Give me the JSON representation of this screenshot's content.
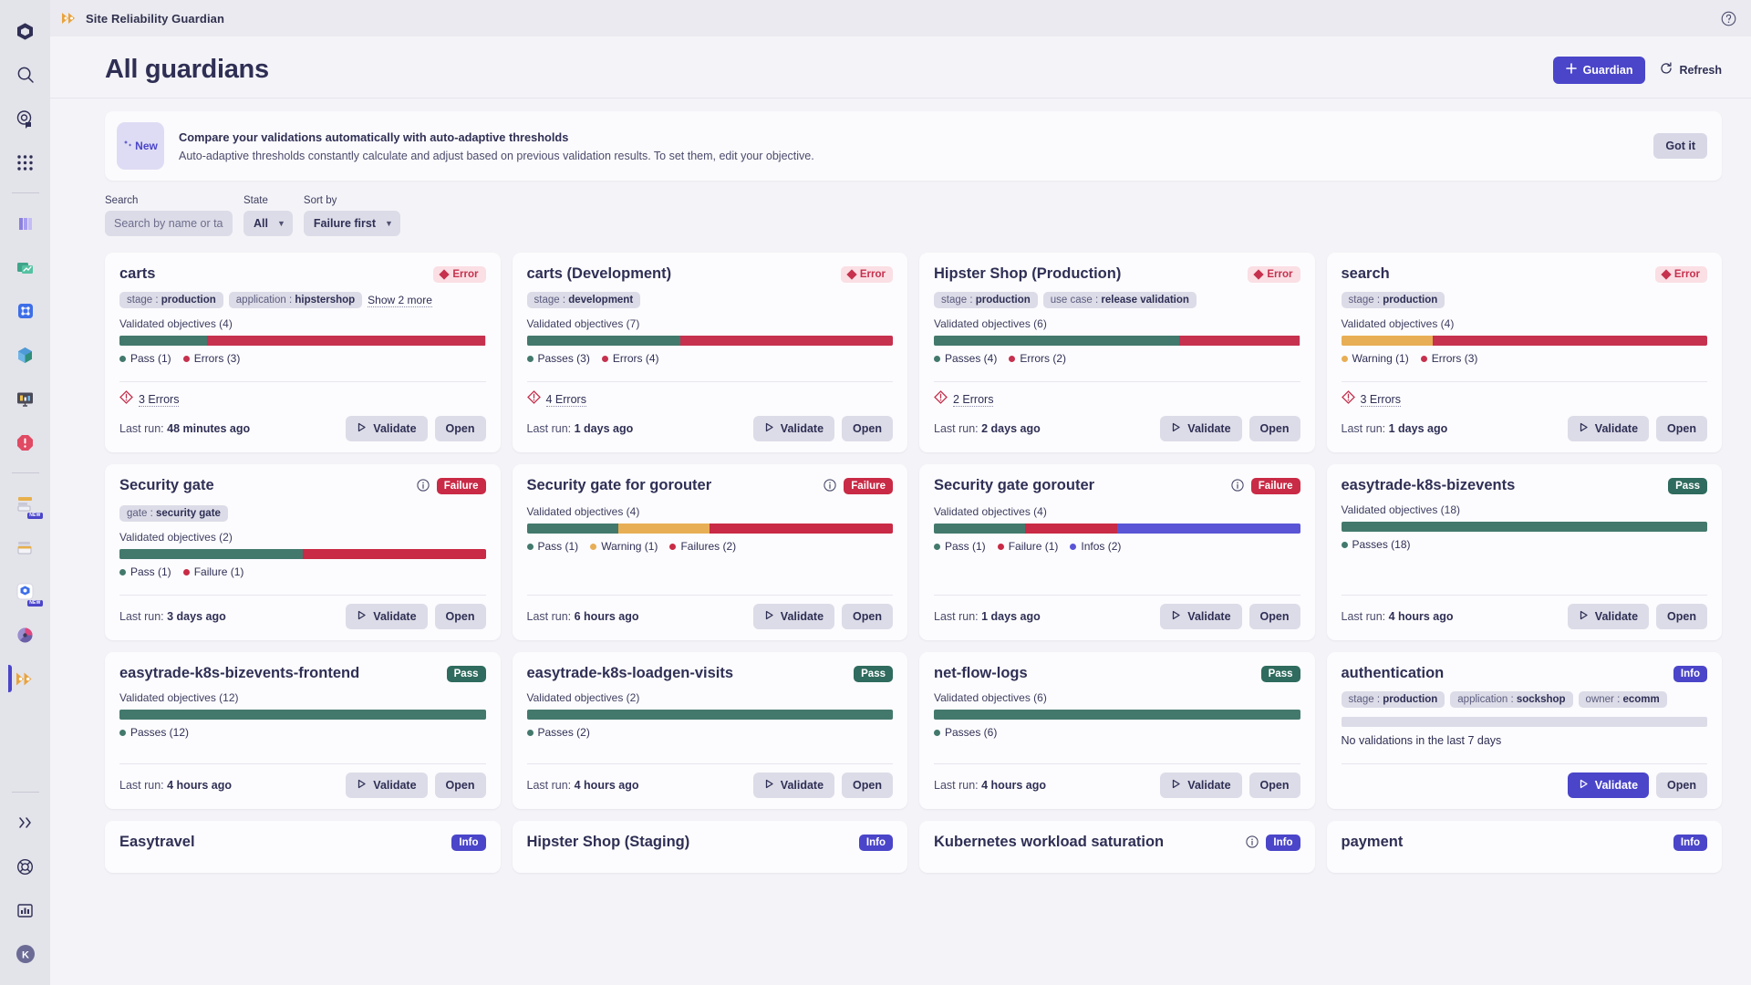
{
  "topbar": {
    "app_title": "Site Reliability Guardian",
    "logo_icon": "guardian-logo-icon",
    "help_icon": "help-circle-icon"
  },
  "page": {
    "title": "All guardians",
    "new_guardian_label": "Guardian",
    "new_guardian_icon": "plus-icon",
    "refresh_label": "Refresh",
    "refresh_icon": "refresh-icon"
  },
  "banner": {
    "chip_label": "New",
    "chip_icon": "sparkle-icon",
    "title": "Compare your validations automatically with auto-adaptive thresholds",
    "subtitle": "Auto-adaptive thresholds constantly calculate and adjust based on previous validation results. To set them, edit your objective.",
    "dismiss_label": "Got it"
  },
  "filters": {
    "search_label": "Search",
    "search_placeholder": "Search by name or tag",
    "search_value": "",
    "state_label": "State",
    "state_value": "All",
    "sort_label": "Sort by",
    "sort_value": "Failure first"
  },
  "colors": {
    "pass": "#43796d",
    "error": "#c6314e",
    "failure": "#c92a45",
    "warning": "#e8ae55",
    "info": "#5a55d6",
    "accent": "#4a45c9",
    "empty": "#dcdce8"
  },
  "labels": {
    "validate": "Validate",
    "open": "Open",
    "validated_objectives": "Validated objectives",
    "last_run_prefix": "Last run:"
  },
  "sidebar": {
    "items": [
      {
        "name": "cube-logo-icon",
        "badge": ""
      },
      {
        "name": "search-icon",
        "badge": ""
      },
      {
        "name": "davis-copilot-icon",
        "badge": ""
      },
      {
        "name": "apps-grid-icon",
        "badge": ""
      },
      {
        "name": "notebooks-icon",
        "badge": ""
      },
      {
        "name": "dashboards-icon",
        "badge": ""
      },
      {
        "name": "kubernetes-app-icon",
        "badge": ""
      },
      {
        "name": "distributed-tracing-icon",
        "badge": ""
      },
      {
        "name": "infrastructure-observability-icon",
        "badge": ""
      },
      {
        "name": "problems-icon",
        "badge": ""
      },
      {
        "name": "workflows-icon",
        "badge": "NEW"
      },
      {
        "name": "segments-icon",
        "badge": ""
      },
      {
        "name": "kubernetes-icon",
        "badge": "NEW"
      },
      {
        "name": "slo-icon",
        "badge": ""
      },
      {
        "name": "site-reliability-guardian-icon",
        "badge": ""
      }
    ],
    "footer_items": [
      {
        "name": "expand-chevrons-icon"
      },
      {
        "name": "lifebuoy-icon"
      },
      {
        "name": "account-usage-icon"
      },
      {
        "name": "user-avatar-icon"
      }
    ]
  },
  "cards": [
    {
      "title": "carts",
      "status": "Error",
      "status_type": "error",
      "has_info": false,
      "tags": [
        {
          "k": "stage",
          "v": "production"
        },
        {
          "k": "application",
          "v": "hipstershop"
        }
      ],
      "show_more": "Show 2 more",
      "objectives_count": "4",
      "segments": [
        {
          "color": "#43796d",
          "pct": 24
        },
        {
          "color": "#c6314e",
          "pct": 76
        }
      ],
      "legend": [
        {
          "label": "Pass (1)",
          "color": "#43796d"
        },
        {
          "label": "Errors (3)",
          "color": "#c6314e"
        }
      ],
      "errors_text": "3 Errors",
      "last_run": "48 minutes ago",
      "validate_accent": false
    },
    {
      "title": "carts (Development)",
      "status": "Error",
      "status_type": "error",
      "has_info": false,
      "tags": [
        {
          "k": "stage",
          "v": "development"
        }
      ],
      "show_more": "",
      "objectives_count": "7",
      "segments": [
        {
          "color": "#43796d",
          "pct": 42
        },
        {
          "color": "#c6314e",
          "pct": 58
        }
      ],
      "legend": [
        {
          "label": "Passes (3)",
          "color": "#43796d"
        },
        {
          "label": "Errors (4)",
          "color": "#c6314e"
        }
      ],
      "errors_text": "4 Errors",
      "last_run": "1 days ago",
      "validate_accent": false
    },
    {
      "title": "Hipster Shop (Production)",
      "status": "Error",
      "status_type": "error",
      "has_info": false,
      "tags": [
        {
          "k": "stage",
          "v": "production"
        },
        {
          "k": "use case",
          "v": "release validation"
        }
      ],
      "show_more": "",
      "objectives_count": "6",
      "segments": [
        {
          "color": "#43796d",
          "pct": 67
        },
        {
          "color": "#c6314e",
          "pct": 33
        }
      ],
      "legend": [
        {
          "label": "Passes (4)",
          "color": "#43796d"
        },
        {
          "label": "Errors (2)",
          "color": "#c6314e"
        }
      ],
      "errors_text": "2 Errors",
      "last_run": "2 days ago",
      "validate_accent": false
    },
    {
      "title": "search",
      "status": "Error",
      "status_type": "error",
      "has_info": false,
      "tags": [
        {
          "k": "stage",
          "v": "production"
        }
      ],
      "show_more": "",
      "objectives_count": "4",
      "segments": [
        {
          "color": "#e8ae55",
          "pct": 25
        },
        {
          "color": "#c6314e",
          "pct": 75
        }
      ],
      "legend": [
        {
          "label": "Warning (1)",
          "color": "#e8ae55"
        },
        {
          "label": "Errors (3)",
          "color": "#c6314e"
        }
      ],
      "errors_text": "3 Errors",
      "last_run": "1 days ago",
      "validate_accent": false
    },
    {
      "title": "Security gate",
      "status": "Failure",
      "status_type": "failure",
      "has_info": true,
      "tags": [
        {
          "k": "gate",
          "v": "security gate"
        }
      ],
      "show_more": "",
      "objectives_count": "2",
      "segments": [
        {
          "color": "#43796d",
          "pct": 50
        },
        {
          "color": "#c92a45",
          "pct": 50
        }
      ],
      "legend": [
        {
          "label": "Pass (1)",
          "color": "#43796d"
        },
        {
          "label": "Failure (1)",
          "color": "#c92a45"
        }
      ],
      "errors_text": "",
      "last_run": "3 days ago",
      "validate_accent": false
    },
    {
      "title": "Security gate for gorouter",
      "status": "Failure",
      "status_type": "failure",
      "has_info": true,
      "tags": [],
      "show_more": "",
      "objectives_count": "4",
      "segments": [
        {
          "color": "#43796d",
          "pct": 25
        },
        {
          "color": "#e8ae55",
          "pct": 25
        },
        {
          "color": "#c92a45",
          "pct": 50
        }
      ],
      "legend": [
        {
          "label": "Pass (1)",
          "color": "#43796d"
        },
        {
          "label": "Warning (1)",
          "color": "#e8ae55"
        },
        {
          "label": "Failures (2)",
          "color": "#c92a45"
        }
      ],
      "errors_text": "",
      "last_run": "6 hours ago",
      "validate_accent": false
    },
    {
      "title": "Security gate gorouter",
      "status": "Failure",
      "status_type": "failure",
      "has_info": true,
      "tags": [],
      "show_more": "",
      "objectives_count": "4",
      "segments": [
        {
          "color": "#43796d",
          "pct": 25
        },
        {
          "color": "#c92a45",
          "pct": 25
        },
        {
          "color": "#5a55d6",
          "pct": 50
        }
      ],
      "legend": [
        {
          "label": "Pass (1)",
          "color": "#43796d"
        },
        {
          "label": "Failure (1)",
          "color": "#c92a45"
        },
        {
          "label": "Infos (2)",
          "color": "#5a55d6"
        }
      ],
      "errors_text": "",
      "last_run": "1 days ago",
      "validate_accent": false
    },
    {
      "title": "easytrade-k8s-bizevents",
      "status": "Pass",
      "status_type": "pass",
      "has_info": false,
      "tags": [],
      "show_more": "",
      "objectives_count": "18",
      "segments": [
        {
          "color": "#43796d",
          "pct": 100
        }
      ],
      "legend": [
        {
          "label": "Passes (18)",
          "color": "#43796d"
        }
      ],
      "errors_text": "",
      "last_run": "4 hours ago",
      "validate_accent": false
    },
    {
      "title": "easytrade-k8s-bizevents-frontend",
      "status": "Pass",
      "status_type": "pass",
      "has_info": false,
      "tags": [],
      "show_more": "",
      "objectives_count": "12",
      "segments": [
        {
          "color": "#43796d",
          "pct": 100
        }
      ],
      "legend": [
        {
          "label": "Passes (12)",
          "color": "#43796d"
        }
      ],
      "errors_text": "",
      "last_run": "4 hours ago",
      "validate_accent": false
    },
    {
      "title": "easytrade-k8s-loadgen-visits",
      "status": "Pass",
      "status_type": "pass",
      "has_info": false,
      "tags": [],
      "show_more": "",
      "objectives_count": "2",
      "segments": [
        {
          "color": "#43796d",
          "pct": 100
        }
      ],
      "legend": [
        {
          "label": "Passes (2)",
          "color": "#43796d"
        }
      ],
      "errors_text": "",
      "last_run": "4 hours ago",
      "validate_accent": false
    },
    {
      "title": "net-flow-logs",
      "status": "Pass",
      "status_type": "pass",
      "has_info": false,
      "tags": [],
      "show_more": "",
      "objectives_count": "6",
      "segments": [
        {
          "color": "#43796d",
          "pct": 100
        }
      ],
      "legend": [
        {
          "label": "Passes (6)",
          "color": "#43796d"
        }
      ],
      "errors_text": "",
      "last_run": "4 hours ago",
      "validate_accent": false
    },
    {
      "title": "authentication",
      "status": "Info",
      "status_type": "info",
      "has_info": false,
      "tags": [
        {
          "k": "stage",
          "v": "production"
        },
        {
          "k": "application",
          "v": "sockshop"
        },
        {
          "k": "owner",
          "v": "ecomm"
        }
      ],
      "show_more": "",
      "objectives_count": "",
      "segments": [],
      "legend": [],
      "no_validations": "No validations in the last 7 days",
      "errors_text": "",
      "last_run": "",
      "validate_accent": true
    },
    {
      "title": "Easytravel",
      "status": "Info",
      "status_type": "info",
      "has_info": false,
      "tags": [],
      "show_more": "",
      "objectives_count": "",
      "segments": [],
      "legend": [],
      "errors_text": "",
      "last_run": "",
      "validate_accent": false,
      "partial": true
    },
    {
      "title": "Hipster Shop (Staging)",
      "status": "Info",
      "status_type": "info",
      "has_info": false,
      "tags": [],
      "show_more": "",
      "objectives_count": "",
      "segments": [],
      "legend": [],
      "errors_text": "",
      "last_run": "",
      "validate_accent": false,
      "partial": true
    },
    {
      "title": "Kubernetes workload saturation",
      "status": "Info",
      "status_type": "info",
      "has_info": true,
      "tags": [],
      "show_more": "",
      "objectives_count": "",
      "segments": [],
      "legend": [],
      "errors_text": "",
      "last_run": "",
      "validate_accent": false,
      "partial": true
    },
    {
      "title": "payment",
      "status": "Info",
      "status_type": "info",
      "has_info": false,
      "tags": [],
      "show_more": "",
      "objectives_count": "",
      "segments": [],
      "legend": [],
      "errors_text": "",
      "last_run": "",
      "validate_accent": false,
      "partial": true
    }
  ]
}
